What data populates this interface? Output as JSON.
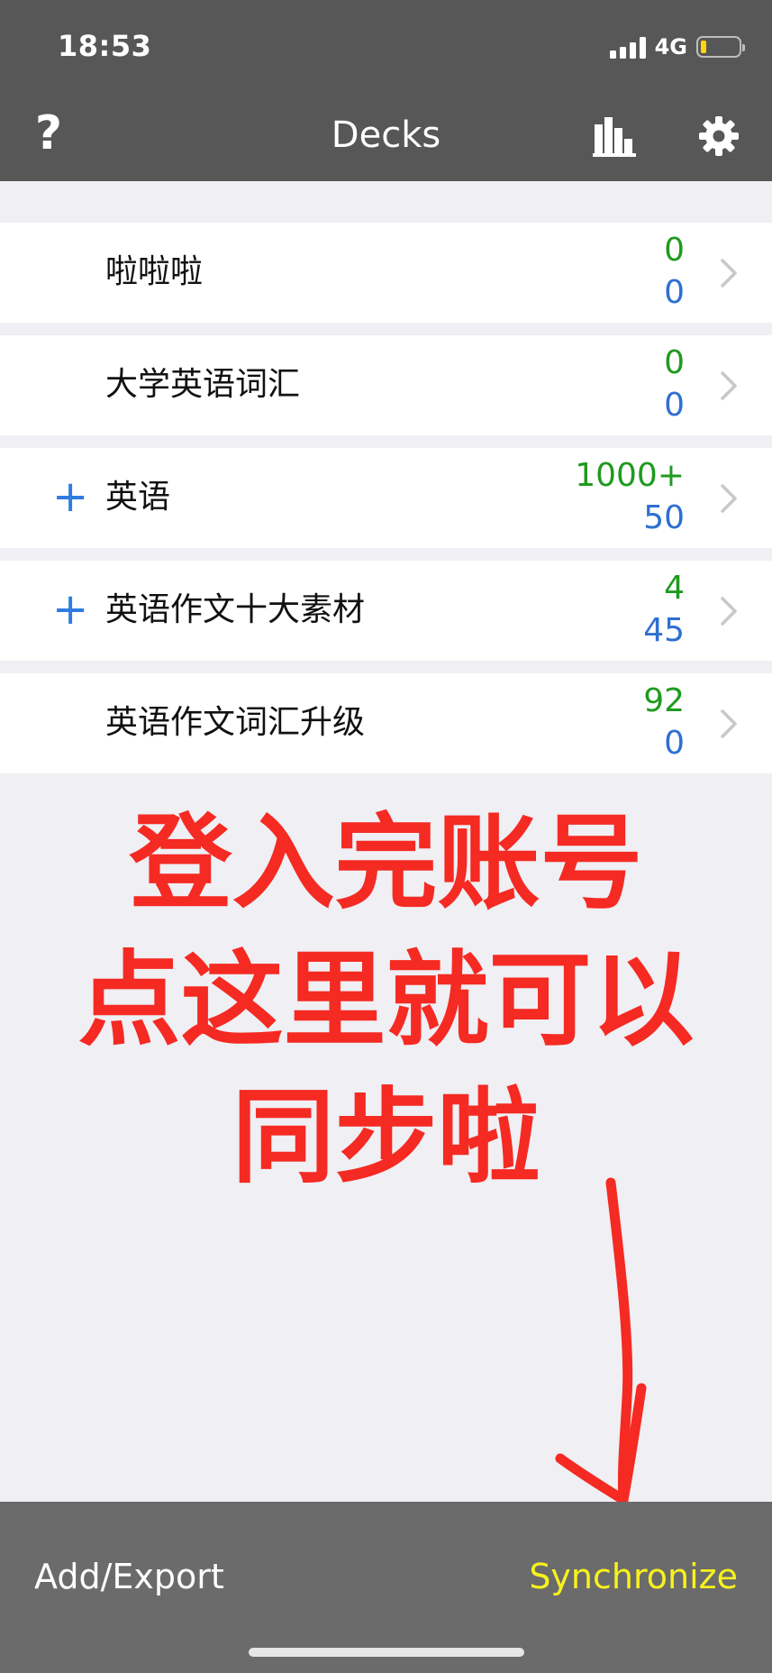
{
  "status_bar": {
    "time": "18:53",
    "network": "4G",
    "battery_level": 0.15
  },
  "header": {
    "title": "Decks",
    "help_label": "?"
  },
  "decks": [
    {
      "name": "啦啦啦",
      "expandable": false,
      "new_count": "0",
      "review_count": "0"
    },
    {
      "name": "大学英语词汇",
      "expandable": false,
      "new_count": "0",
      "review_count": "0"
    },
    {
      "name": "英语",
      "expandable": true,
      "expand_label": "+",
      "new_count": "1000+",
      "review_count": "50"
    },
    {
      "name": "英语作文十大素材",
      "expandable": true,
      "expand_label": "+",
      "new_count": "4",
      "review_count": "45"
    },
    {
      "name": "英语作文词汇升级",
      "expandable": false,
      "new_count": "92",
      "review_count": "0"
    }
  ],
  "annotation": {
    "lines": [
      "登入完账号",
      "点这里就可以",
      "同步啦"
    ]
  },
  "bottom_bar": {
    "add_export": "Add/Export",
    "synchronize": "Synchronize"
  },
  "colors": {
    "header_bg": "#575757",
    "new_count": "#1f9a1f",
    "review_count": "#2f6fd1",
    "sync": "#f7f21c",
    "annotation": "#f52a22"
  }
}
